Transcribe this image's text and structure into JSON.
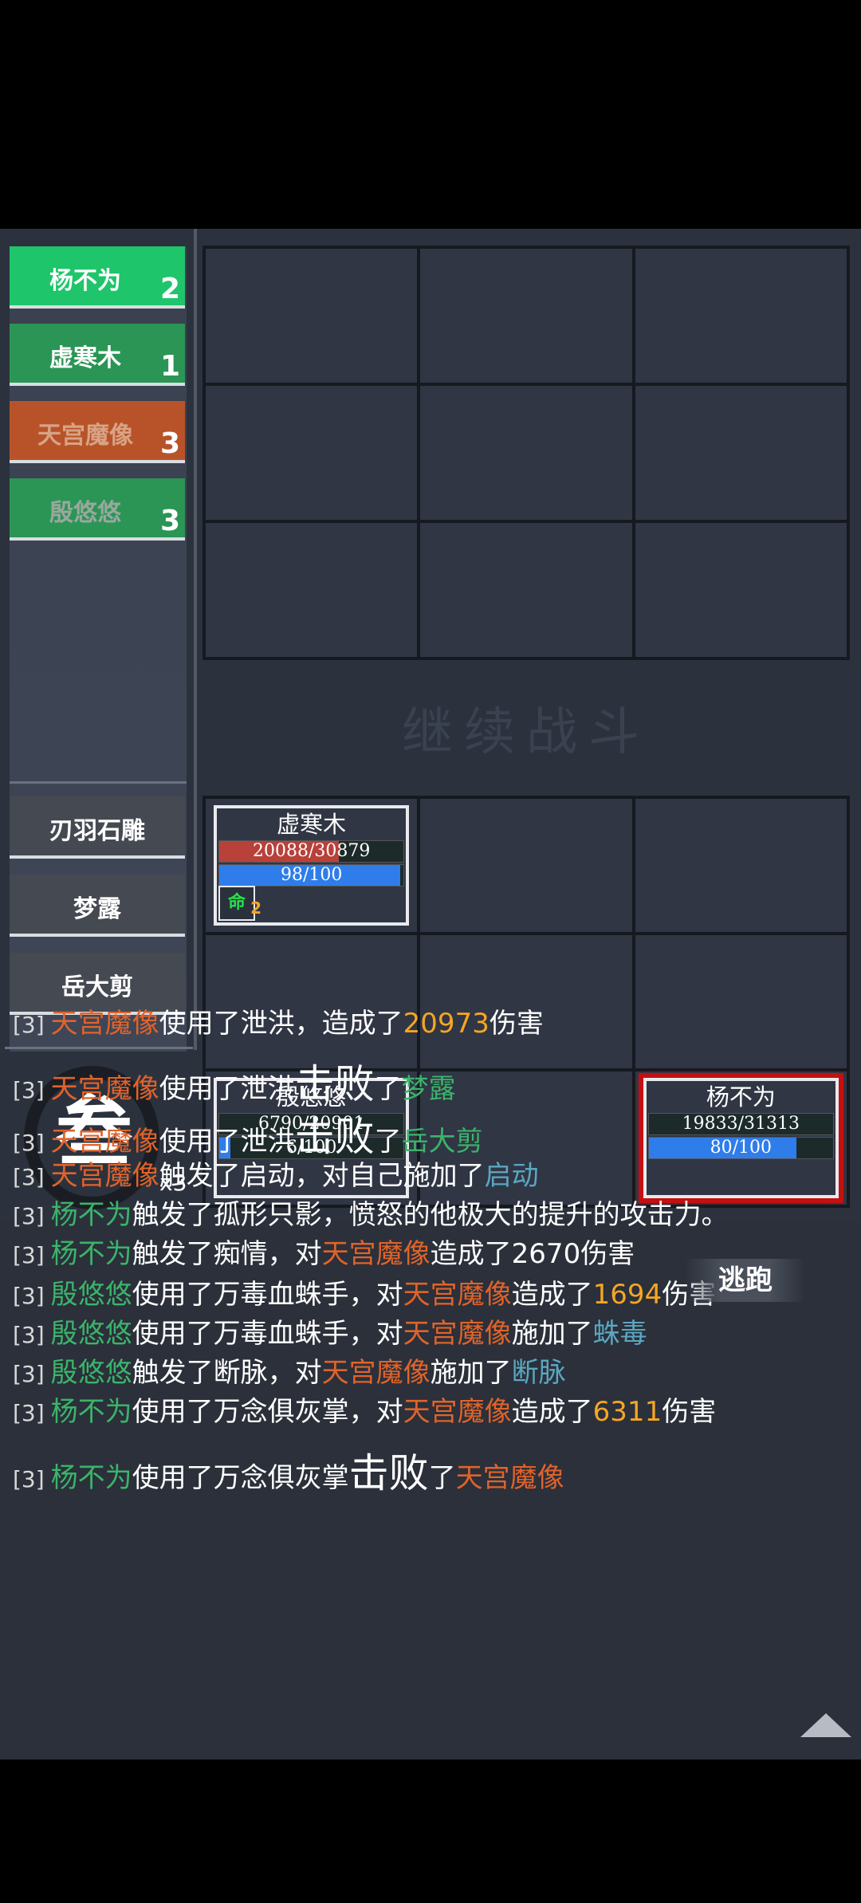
{
  "turn_order": [
    {
      "name": "杨不为",
      "num": "2",
      "style": "green active"
    },
    {
      "name": "虚寒木",
      "num": "1",
      "style": "green"
    },
    {
      "name": "天宫魔像",
      "num": "3",
      "style": "orange"
    },
    {
      "name": "殷悠悠",
      "num": "3",
      "style": "green dim"
    }
  ],
  "defeated": [
    "刃羽石雕",
    "梦露",
    "岳大剪"
  ],
  "continue_label": "继续战斗",
  "round": {
    "glyph": "叁",
    "multiplier": "x3"
  },
  "flee_label": "逃跑",
  "units": {
    "xuhanmu": {
      "name": "虚寒木",
      "hp": "20088/30879",
      "hp_frac": 0.65,
      "mp": "98/100",
      "mp_frac": 0.98,
      "buff": "命",
      "buff_count": "2"
    },
    "yinyouyou": {
      "name": "殷悠悠",
      "hp": "6790/20901",
      "hp_frac": 0.0,
      "mp": "6/100",
      "mp_frac": 0.06
    },
    "yangbuwei": {
      "name": "杨不为",
      "hp": "19833/31313",
      "hp_frac": 0.0,
      "mp": "80/100",
      "mp_frac": 0.8
    }
  },
  "log": [
    {
      "idx": "[3]",
      "parts": [
        [
          "天宫魔像",
          "o"
        ],
        [
          "使用了泄洪，造成了",
          ""
        ],
        [
          "20973",
          "y"
        ],
        [
          "伤害",
          ""
        ]
      ]
    },
    {
      "idx": "[3]",
      "parts": [
        [
          "天宫魔像",
          "o"
        ],
        [
          "使用了泄洪",
          ""
        ],
        [
          "击败",
          "big"
        ],
        [
          "了",
          ""
        ],
        [
          "梦露",
          "g"
        ]
      ]
    },
    {
      "idx": "[3]",
      "parts": [
        [
          "天宫魔像",
          "o"
        ],
        [
          "使用了泄洪",
          ""
        ],
        [
          "击败",
          "big"
        ],
        [
          "了",
          ""
        ],
        [
          "岳大剪",
          "g"
        ]
      ]
    },
    {
      "idx": "[3]",
      "parts": [
        [
          "天宫魔像",
          "o"
        ],
        [
          "触发了启动，对自己施加了",
          ""
        ],
        [
          "启动",
          "b"
        ]
      ]
    },
    {
      "idx": "[3]",
      "parts": [
        [
          "杨不为",
          "g"
        ],
        [
          "触发了孤形只影，愤怒的他极大的提升的攻击力。",
          ""
        ]
      ]
    },
    {
      "idx": "[3]",
      "parts": [
        [
          "杨不为",
          "g"
        ],
        [
          "触发了痴情，对",
          ""
        ],
        [
          "天宫魔像",
          "o"
        ],
        [
          "造成了2670伤害",
          ""
        ]
      ]
    },
    {
      "idx": "[3]",
      "parts": [
        [
          "殷悠悠",
          "g"
        ],
        [
          "使用了万毒血蛛手，对",
          ""
        ],
        [
          "天宫魔像",
          "o"
        ],
        [
          "造成了",
          ""
        ],
        [
          "1694",
          "y"
        ],
        [
          "伤害",
          ""
        ]
      ]
    },
    {
      "idx": "[3]",
      "parts": [
        [
          "殷悠悠",
          "g"
        ],
        [
          "使用了万毒血蛛手，对",
          ""
        ],
        [
          "天宫魔像",
          "o"
        ],
        [
          "施加了",
          ""
        ],
        [
          "蛛毒",
          "b"
        ]
      ]
    },
    {
      "idx": "[3]",
      "parts": [
        [
          "殷悠悠",
          "g"
        ],
        [
          "触发了断脉，对",
          ""
        ],
        [
          "天宫魔像",
          "o"
        ],
        [
          "施加了",
          ""
        ],
        [
          "断脉",
          "b"
        ]
      ]
    },
    {
      "idx": "[3]",
      "parts": [
        [
          "杨不为",
          "g"
        ],
        [
          "使用了万念俱灰掌，对",
          ""
        ],
        [
          "天宫魔像",
          "o"
        ],
        [
          "造成了",
          ""
        ],
        [
          "6311",
          "y"
        ],
        [
          "伤害",
          ""
        ]
      ]
    },
    {
      "idx": "[3]",
      "parts": [
        [
          "杨不为",
          "g"
        ],
        [
          "使用了万念俱灰掌",
          ""
        ],
        [
          "击败",
          "big"
        ],
        [
          "了",
          ""
        ],
        [
          "天宫魔像",
          "o"
        ]
      ]
    }
  ],
  "colors": {
    "ally": "#3bb46a",
    "enemy": "#e0632a",
    "number": "#f5a623",
    "status": "#5aa7c0"
  }
}
